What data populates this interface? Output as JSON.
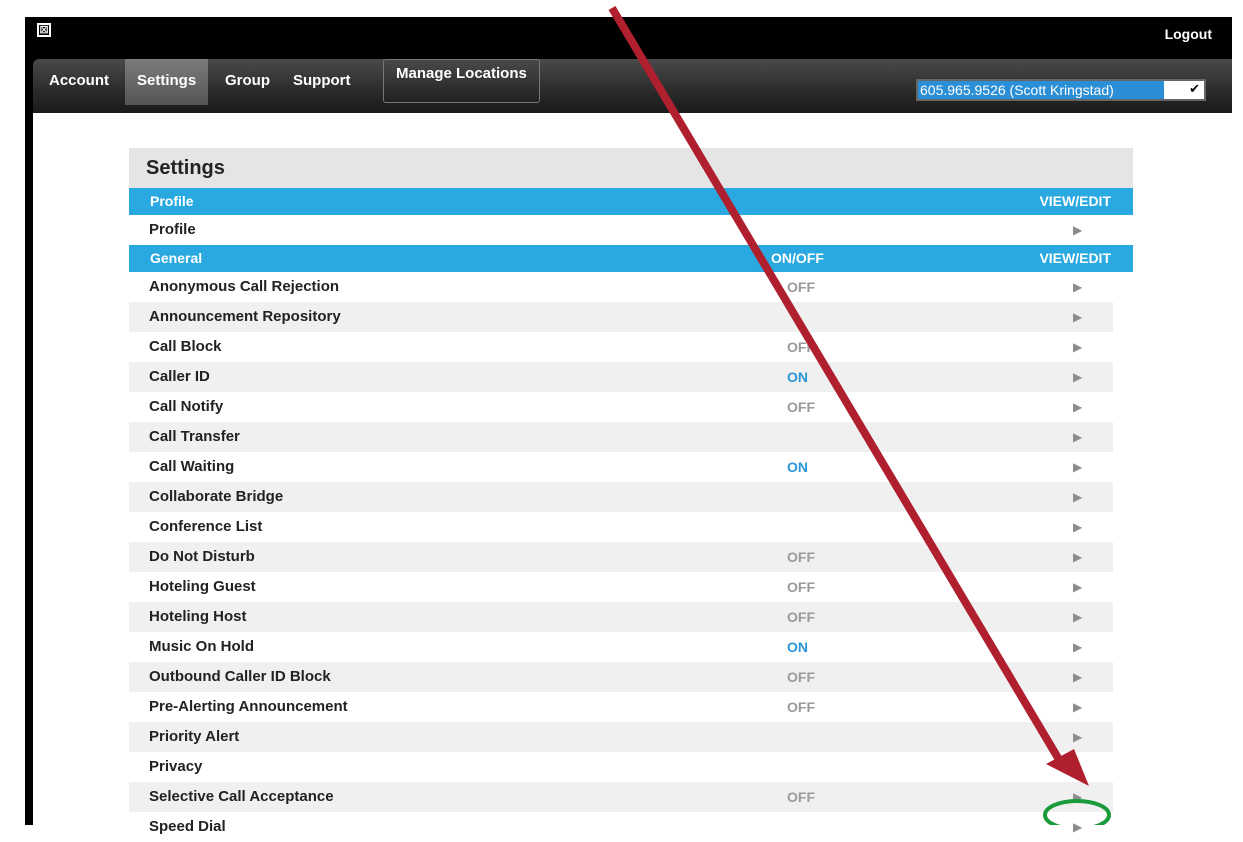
{
  "header": {
    "close_glyph": "⊠",
    "logout_label": "Logout"
  },
  "nav": {
    "tabs": [
      {
        "label": "Account"
      },
      {
        "label": "Settings"
      },
      {
        "label": "Group"
      },
      {
        "label": "Support"
      },
      {
        "label": "Manage Locations"
      }
    ],
    "account_selector": {
      "value": "605.965.9526 (Scott Kringstad)",
      "icon": "chevron-down-icon"
    }
  },
  "settings": {
    "title": "Settings",
    "profile_section": {
      "label": "Profile",
      "view_label": "VIEW/EDIT"
    },
    "profile_row": {
      "label": "Profile"
    },
    "general_section": {
      "label": "General",
      "onoff_label": "ON/OFF",
      "view_label": "VIEW/EDIT"
    },
    "arrow_glyph": "▶",
    "rows": [
      {
        "label": "Anonymous Call Rejection",
        "status": "OFF"
      },
      {
        "label": "Announcement Repository",
        "status": ""
      },
      {
        "label": "Call Block",
        "status": "OFF"
      },
      {
        "label": "Caller ID",
        "status": "ON"
      },
      {
        "label": "Call Notify",
        "status": "OFF"
      },
      {
        "label": "Call Transfer",
        "status": ""
      },
      {
        "label": "Call Waiting",
        "status": "ON"
      },
      {
        "label": "Collaborate Bridge",
        "status": ""
      },
      {
        "label": "Conference List",
        "status": ""
      },
      {
        "label": "Do Not Disturb",
        "status": "OFF"
      },
      {
        "label": "Hoteling Guest",
        "status": "OFF"
      },
      {
        "label": "Hoteling Host",
        "status": "OFF"
      },
      {
        "label": "Music On Hold",
        "status": "ON"
      },
      {
        "label": "Outbound Caller ID Block",
        "status": "OFF"
      },
      {
        "label": "Pre-Alerting Announcement",
        "status": "OFF"
      },
      {
        "label": "Priority Alert",
        "status": ""
      },
      {
        "label": "Privacy",
        "status": ""
      },
      {
        "label": "Selective Call Acceptance",
        "status": "OFF"
      },
      {
        "label": "Speed Dial",
        "status": ""
      }
    ]
  },
  "colors": {
    "annotation_arrow": "#b01f2e",
    "annotation_circle": "#1a9a3a",
    "section_bar": "#29a9e0",
    "on_status": "#2a94d6"
  }
}
